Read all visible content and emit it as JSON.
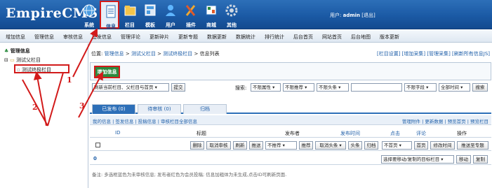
{
  "header": {
    "logo_text": "EmpireCMS",
    "nav": [
      {
        "label": "系统",
        "icon": "globe-icon"
      },
      {
        "label": "信息",
        "icon": "document-icon",
        "active": true
      },
      {
        "label": "栏目",
        "icon": "folder-icon"
      },
      {
        "label": "模板",
        "icon": "template-icon"
      },
      {
        "label": "用户",
        "icon": "user-icon"
      },
      {
        "label": "插件",
        "icon": "tools-icon"
      },
      {
        "label": "商城",
        "icon": "shop-icon"
      },
      {
        "label": "其他",
        "icon": "gear-icon"
      }
    ],
    "user_prefix": "用户:",
    "username": "admin",
    "logout": "[退出]"
  },
  "menubar": [
    "增加信息",
    "管理信息",
    "审核信息",
    "签发信息",
    "管理评论",
    "更新碎片",
    "更新专题",
    "数据更新",
    "数据统计",
    "排行统计",
    "后台首页",
    "网站首页",
    "后台地图",
    "版本更新"
  ],
  "sidebar": {
    "title": "管理信息",
    "parent": "测试父栏目",
    "child": "测试终极栏目"
  },
  "breadcrumb": {
    "prefix": "位置:",
    "items": [
      "管理信息",
      "测试父栏目",
      "测试终极栏目",
      "信息列表"
    ],
    "sep": ">"
  },
  "top_links": "[栏目设置] [增加采集] [管理采集] [刷新所有信息JS]",
  "add_button": "增加信息",
  "toolbar": {
    "refresh_select": "刷新当前栏目、父栏目与首页",
    "submit": "提交",
    "search_label": "搜索:",
    "s1": "不限属性",
    "s2": "不限推荐",
    "s3": "不限头条",
    "s4": "不限字段",
    "s5": "全部时间",
    "search_btn": "搜索"
  },
  "tabs": [
    "已发布 (0)",
    "待审核 (0)",
    "归档"
  ],
  "filters": {
    "left": "我的信息 | 签发信息 | 投稿信息 | 审核栏目全部信息",
    "right": "管理附件 | 更新数据 | 预览首页 | 预览栏目"
  },
  "table_header": [
    "ID",
    "标题",
    "发布者",
    "发布时间",
    "点击",
    "评论",
    "操作"
  ],
  "actions": {
    "buttons": [
      "删除",
      "取消审核",
      "刷新",
      "推送",
      "推荐",
      "取消头条",
      "头条",
      "归档",
      "首页",
      "修改时间",
      "推送至专题"
    ],
    "sel_recommend": "不推荐",
    "sel_home": "不首页"
  },
  "row2": {
    "count": "0",
    "move_select": "选择要移动/复制的目标栏目",
    "move": "移动",
    "copy": "复制"
  },
  "note": "备注: 多选框蓝色为未审核信息; 发布者红色为会员投稿; 信息加粗体为未生成,点击ID可刷新页面.",
  "annotations": [
    "1",
    "2",
    "3"
  ],
  "colors": {
    "header": "#1b5aa5",
    "highlight": "#d21a1a",
    "add_button": "#2b8a3e",
    "link": "#1f5fa9"
  }
}
